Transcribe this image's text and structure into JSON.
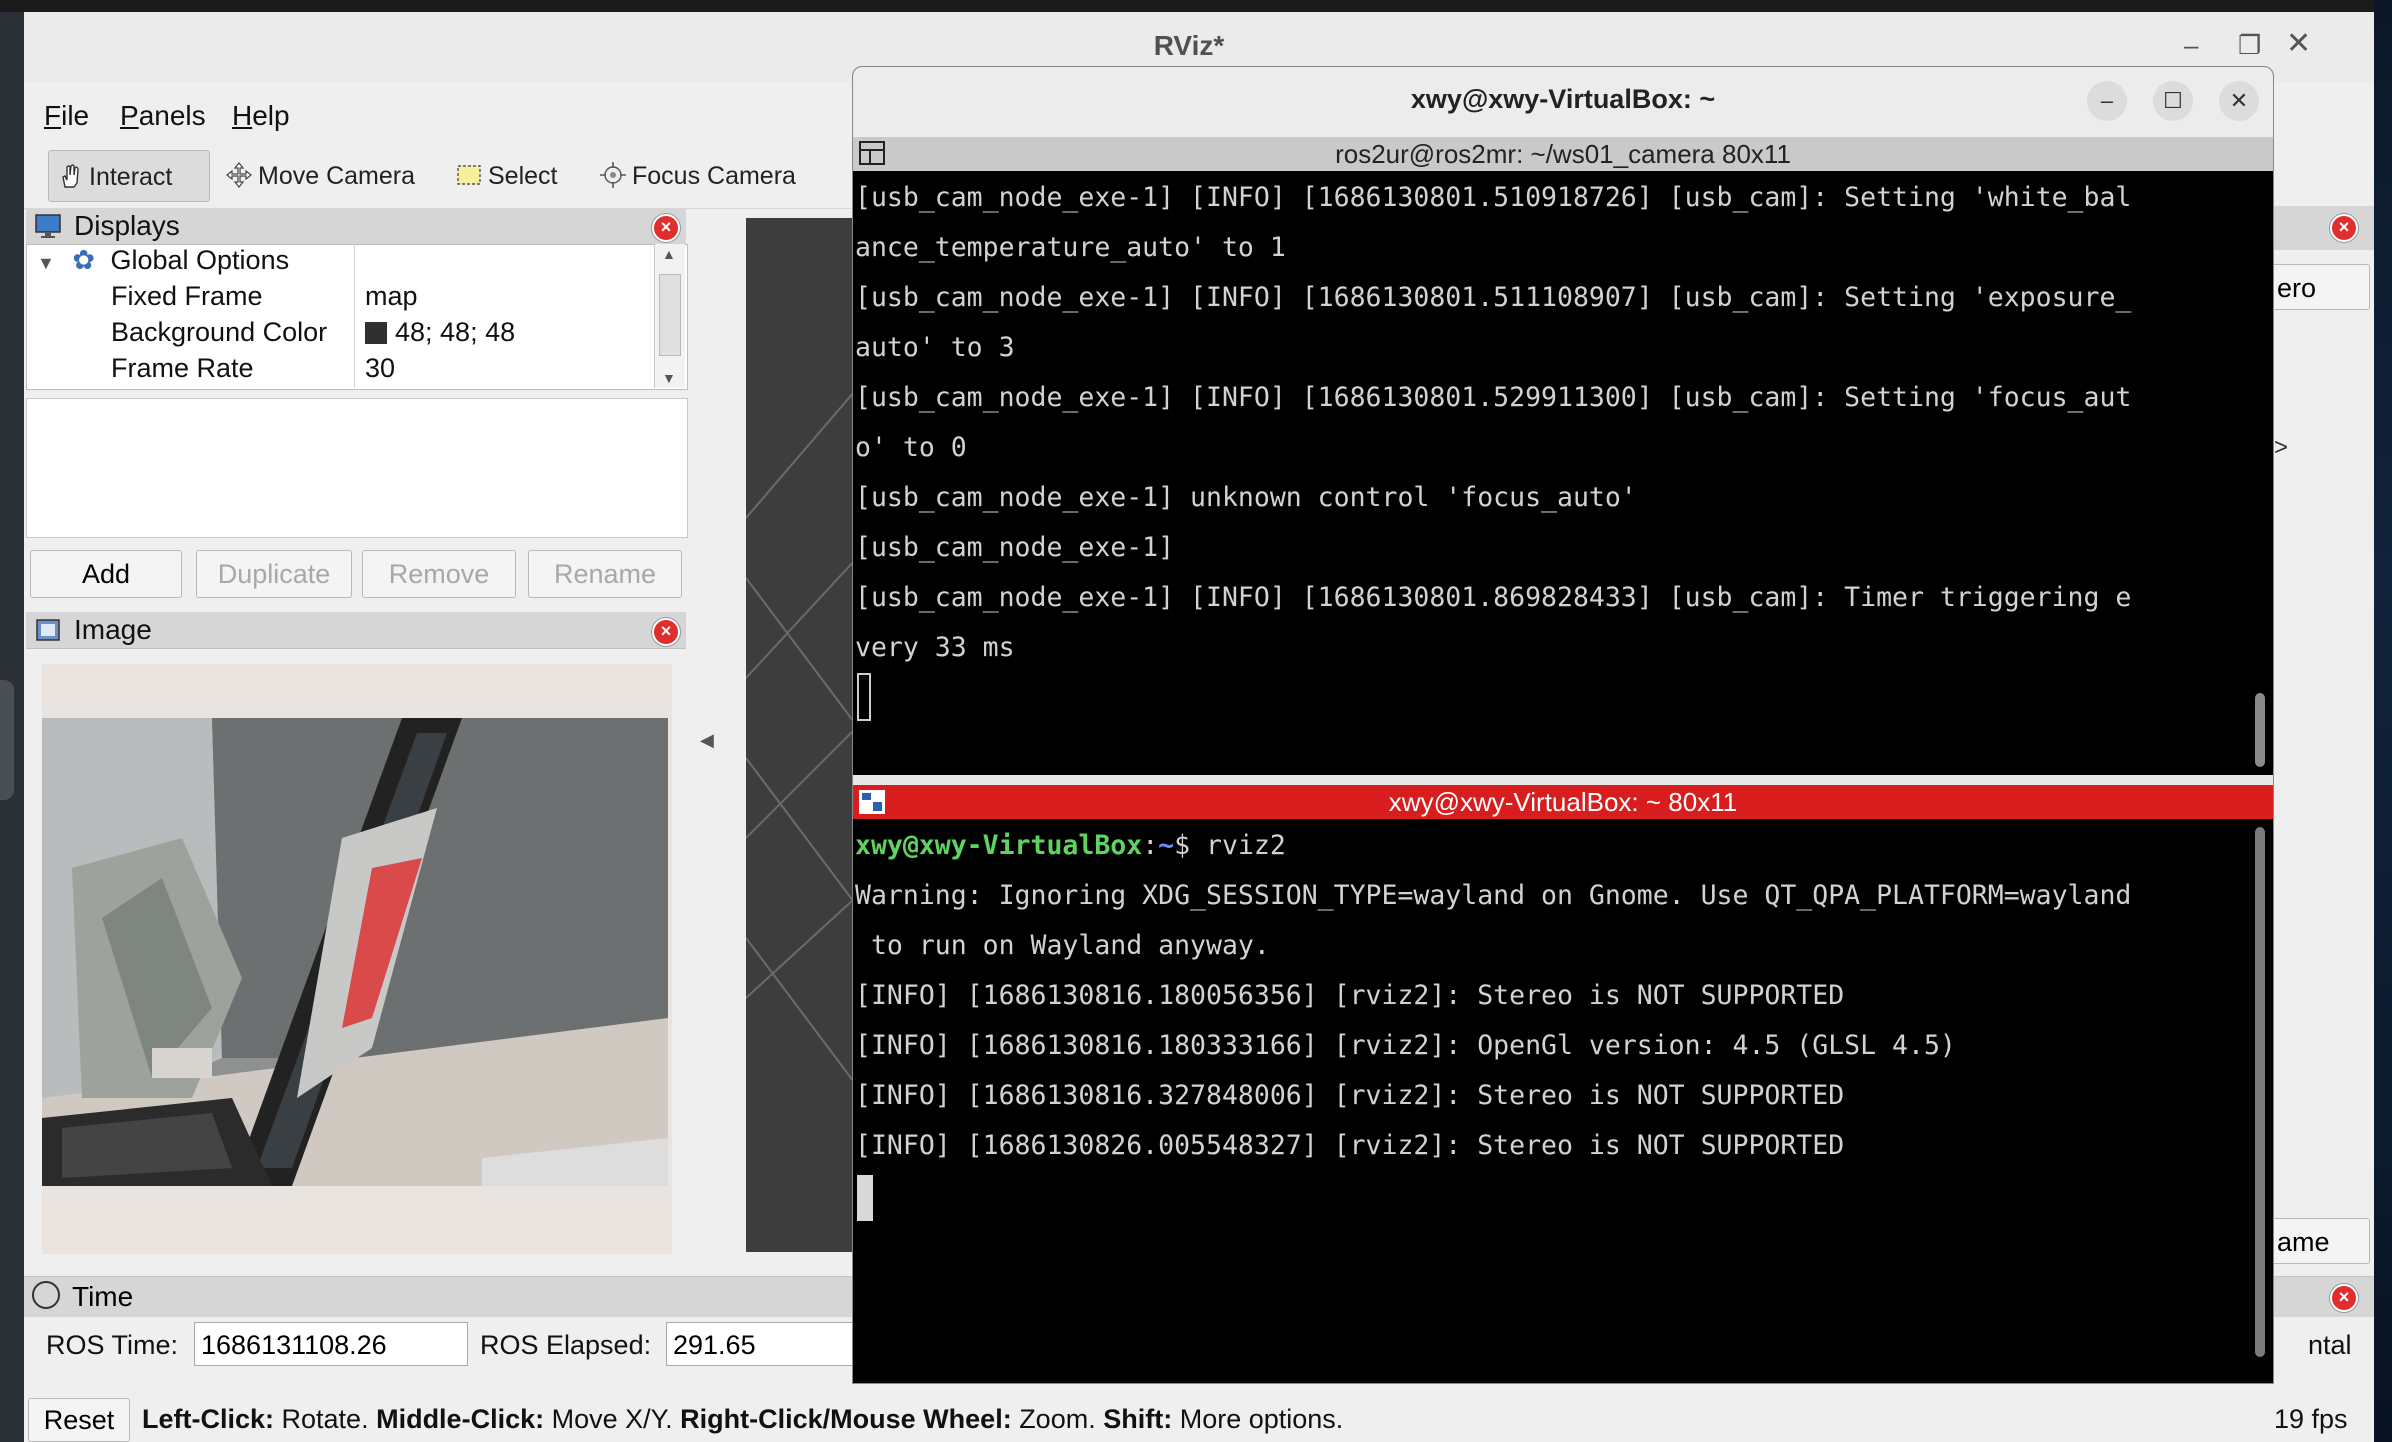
{
  "rviz": {
    "title": "RViz*",
    "menu": [
      "File",
      "Panels",
      "Help"
    ],
    "tools": [
      "Interact",
      "Move Camera",
      "Select",
      "Focus Camera"
    ],
    "displays_panel": {
      "title": "Displays",
      "rows": [
        {
          "name": "Global Options",
          "value": ""
        },
        {
          "name": "Fixed Frame",
          "value": "map"
        },
        {
          "name": "Background Color",
          "value": "48; 48; 48"
        },
        {
          "name": "Frame Rate",
          "value": "30"
        }
      ],
      "buttons": [
        "Add",
        "Duplicate",
        "Remove",
        "Rename"
      ]
    },
    "image_panel": {
      "title": "Image"
    },
    "right_partial": {
      "top_button": "ero",
      "arrow": ">",
      "bottom_button": "ame",
      "time_right": "ntal"
    },
    "time_panel": {
      "title": "Time",
      "ros_time_label": "ROS Time:",
      "ros_time": "1686131108.26",
      "ros_elapsed_label": "ROS Elapsed:",
      "ros_elapsed": "291.65"
    },
    "status": {
      "reset": "Reset",
      "k1": "Left-Click:",
      "v1": " Rotate. ",
      "k2": "Middle-Click:",
      "v2": " Move X/Y. ",
      "k3": "Right-Click/Mouse Wheel:",
      "v3": " Zoom. ",
      "k4": "Shift:",
      "v4": " More options.",
      "fps": "19 fps"
    },
    "colors": {
      "background_swatch": "#303030"
    }
  },
  "terminal": {
    "title": "xwy@xwy-VirtualBox: ~",
    "pane1_title": "ros2ur@ros2mr: ~/ws01_camera 80x11",
    "pane1_lines": [
      "[usb_cam_node_exe-1] [INFO] [1686130801.510918726] [usb_cam]: Setting 'white_bal",
      "ance_temperature_auto' to 1",
      "[usb_cam_node_exe-1] [INFO] [1686130801.511108907] [usb_cam]: Setting 'exposure_",
      "auto' to 3",
      "[usb_cam_node_exe-1] [INFO] [1686130801.529911300] [usb_cam]: Setting 'focus_aut",
      "o' to 0",
      "[usb_cam_node_exe-1] unknown control 'focus_auto'",
      "[usb_cam_node_exe-1]",
      "[usb_cam_node_exe-1] [INFO] [1686130801.869828433] [usb_cam]: Timer triggering e",
      "very 33 ms"
    ],
    "pane2_title": "xwy@xwy-VirtualBox: ~ 80x11",
    "prompt_user": "xwy@xwy-VirtualBox",
    "prompt_sep": ":",
    "prompt_path": "~",
    "prompt_cmd": "$ rviz2",
    "pane2_lines": [
      "Warning: Ignoring XDG_SESSION_TYPE=wayland on Gnome. Use QT_QPA_PLATFORM=wayland",
      " to run on Wayland anyway.",
      "[INFO] [1686130816.180056356] [rviz2]: Stereo is NOT SUPPORTED",
      "[INFO] [1686130816.180333166] [rviz2]: OpenGl version: 4.5 (GLSL 4.5)",
      "[INFO] [1686130816.327848006] [rviz2]: Stereo is NOT SUPPORTED",
      "[INFO] [1686130826.005548327] [rviz2]: Stereo is NOT SUPPORTED"
    ],
    "colors": {
      "pane2_header": "#d71d1d",
      "prompt_user": "#5fd35f",
      "prompt_path": "#6f8cff"
    }
  }
}
